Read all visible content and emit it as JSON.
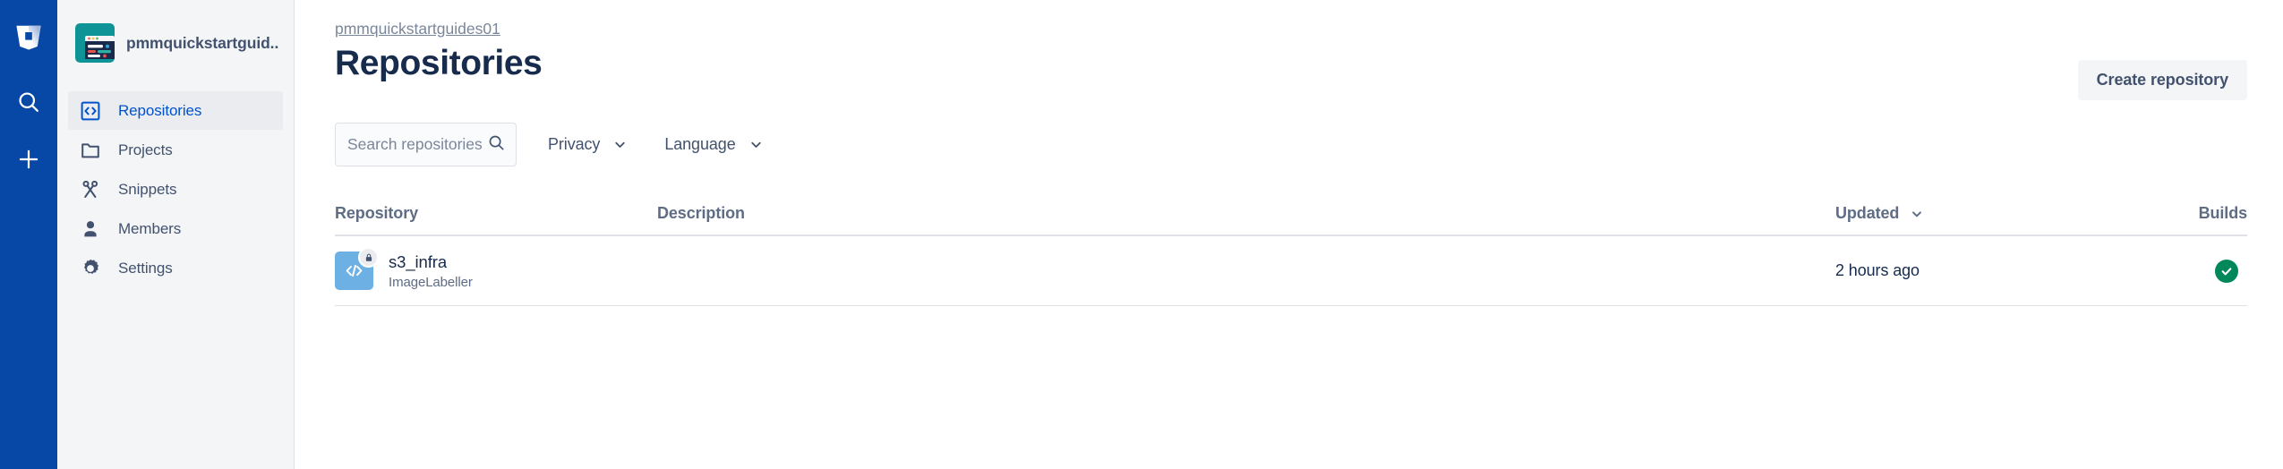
{
  "rail": {
    "logo_icon": "bitbucket-logo-icon",
    "items": [
      {
        "icon": "search-icon",
        "name": "search"
      },
      {
        "icon": "plus-icon",
        "name": "create"
      }
    ]
  },
  "sidebar": {
    "workspace": {
      "name": "pmmquickstartguid...",
      "avatar_icon": "workspace-avatar-icon"
    },
    "items": [
      {
        "label": "Repositories",
        "icon": "code-brackets-icon",
        "active": true
      },
      {
        "label": "Projects",
        "icon": "folder-icon",
        "active": false
      },
      {
        "label": "Snippets",
        "icon": "scissors-icon",
        "active": false
      },
      {
        "label": "Members",
        "icon": "person-icon",
        "active": false
      },
      {
        "label": "Settings",
        "icon": "gear-icon",
        "active": false
      }
    ]
  },
  "header": {
    "breadcrumb": "pmmquickstartguides01",
    "title": "Repositories",
    "create_button": "Create repository"
  },
  "filters": {
    "search_placeholder": "Search repositories",
    "search_value": "",
    "search_icon": "search-icon",
    "privacy_label": "Privacy",
    "language_label": "Language",
    "chevron_icon": "chevron-down-icon"
  },
  "table": {
    "columns": {
      "repository": "Repository",
      "description": "Description",
      "updated": "Updated",
      "builds": "Builds"
    },
    "sort_icon": "chevron-down-icon",
    "rows": [
      {
        "name": "s3_infra",
        "project": "ImageLabeller",
        "description": "",
        "updated": "2 hours ago",
        "build_status": "success",
        "private": true,
        "avatar_icon": "code-brackets-icon",
        "lock_icon": "lock-icon",
        "build_icon": "check-circle-icon"
      }
    ]
  },
  "colors": {
    "rail_blue": "#0747A6",
    "sidebar_bg": "#F4F5F7",
    "link_blue": "#0052CC",
    "text_dark": "#172B4D",
    "text_muted": "#5E6C84",
    "build_success_green": "#00875A",
    "repo_avatar_blue": "#6CB0E4"
  }
}
